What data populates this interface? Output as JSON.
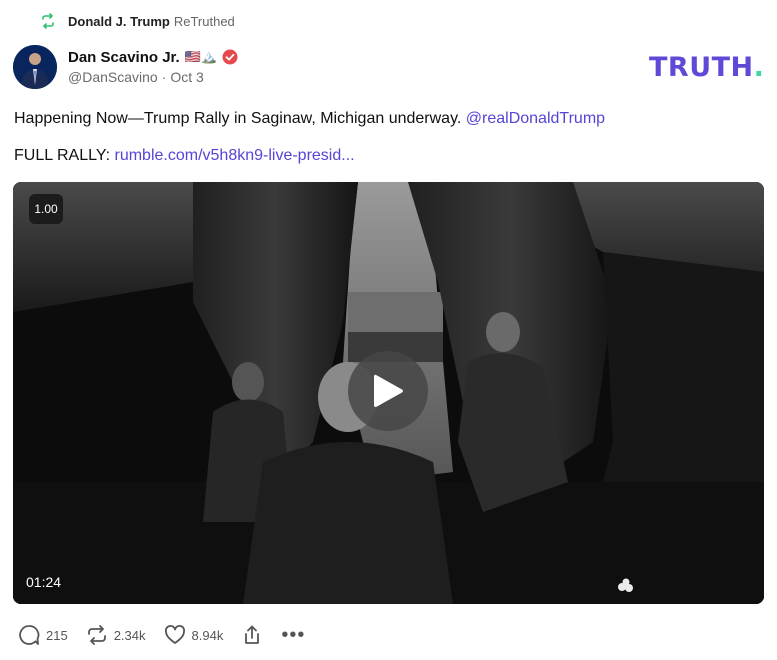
{
  "retruth": {
    "name": "Donald J. Trump",
    "label": "ReTruthed"
  },
  "author": {
    "name": "Dan Scavino Jr.",
    "emoji": "🇺🇸🏔️",
    "handle": "@DanScavino",
    "separator": "·",
    "date": "Oct 3",
    "verified": true
  },
  "logo": {
    "text": "TRUTH",
    "dot": ".",
    "color": "#5f49d6",
    "dot_color": "#3ed6a1"
  },
  "post": {
    "line1": "Happening Now—Trump Rally in Saginaw, Michigan underway.",
    "mention": "@realDonaldTrump",
    "line2_prefix": "FULL RALLY:",
    "line2_link": "rumble.com/v5h8kn9-live-presid..."
  },
  "video": {
    "speed": "1.00",
    "duration": "01:24"
  },
  "actions": {
    "replies": "215",
    "retruths": "2.34k",
    "likes": "8.94k",
    "share_icon": "share-icon",
    "more_label": "•••"
  },
  "colors": {
    "accent": "#5445d6",
    "retruth_green": "#2fbf71",
    "verified": "#e5484d"
  }
}
